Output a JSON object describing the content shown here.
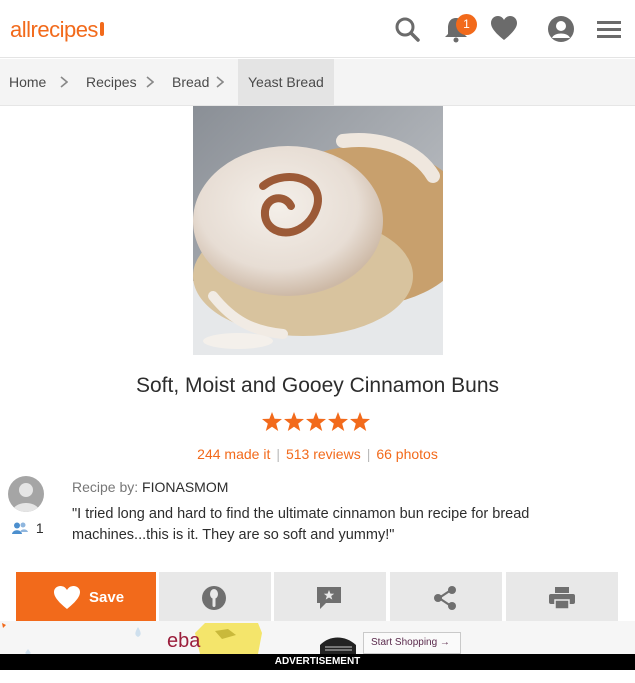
{
  "header": {
    "logo_text": "allrecipes",
    "notification_count": "1",
    "icons": [
      "search-icon",
      "bell-icon",
      "heart-icon",
      "user-icon",
      "menu-icon"
    ]
  },
  "breadcrumb": {
    "items": [
      "Home",
      "Recipes",
      "Bread",
      "Yeast Bread"
    ]
  },
  "recipe": {
    "title": "Soft, Moist and Gooey Cinnamon Buns",
    "rating": 5,
    "made_it": "244 made it",
    "reviews": "513 reviews",
    "photos": "66 photos",
    "author_label": "Recipe by:",
    "author_name": "FIONASMOM",
    "followers": "1",
    "description": "\"I tried long and hard to find the ultimate cinnamon bun recipe for bread machines...this is it. They are so soft and yummy!\""
  },
  "actions": {
    "save_label": "Save",
    "icons": [
      "heart-icon",
      "i-made-it-icon",
      "review-icon",
      "share-icon",
      "print-icon"
    ]
  },
  "ad": {
    "brand": "eba",
    "cta": "Start Shopping →",
    "label": "ADVERTISEMENT"
  },
  "colors": {
    "accent": "#f26a1b",
    "breadcrumb_bg": "#f4f4f4",
    "action_bg": "#e8e8e8"
  }
}
